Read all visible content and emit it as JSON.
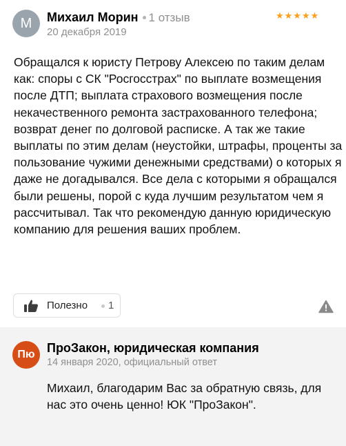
{
  "review": {
    "avatar_letter": "М",
    "author_name": "Михаил Морин",
    "review_count": "1 отзыв",
    "stars": "★★★★★",
    "rating": 5,
    "date": "20 декабря 2019",
    "text": "Обращался к юристу Петрову Алексею по таким делам как: споры с СК \"Росгосстрах\" по выплате возмещения после ДТП; выплата страхового возмещения после некачественного ремонта застрахованного телефона; возврат денег по долговой расписке. А так же такие выплаты по этим делам (неустойки, штрафы, проценты за пользование чужими денежными средствами) о которых я даже не догадывался. Все дела с которыми я обращался были решены, порой с куда лучшим результатом чем я рассчитывал. Так что рекомендую данную юридическую компанию для решения ваших проблем.",
    "useful_label": "Полезно",
    "useful_count": "1",
    "colors": {
      "stars": "#fc9f1a",
      "avatar": "#9aa4ad"
    }
  },
  "reply": {
    "logo_text": "Пю",
    "company_name": "ПроЗакон, юридическая компания",
    "meta": "14 января 2020, официальный ответ",
    "text": "Михаил, благодарим Вас за обратную связь, для нас это очень ценно! ЮК \"ПроЗакон\".",
    "colors": {
      "logo": "#d64d16",
      "background": "#f3f3f3"
    }
  }
}
